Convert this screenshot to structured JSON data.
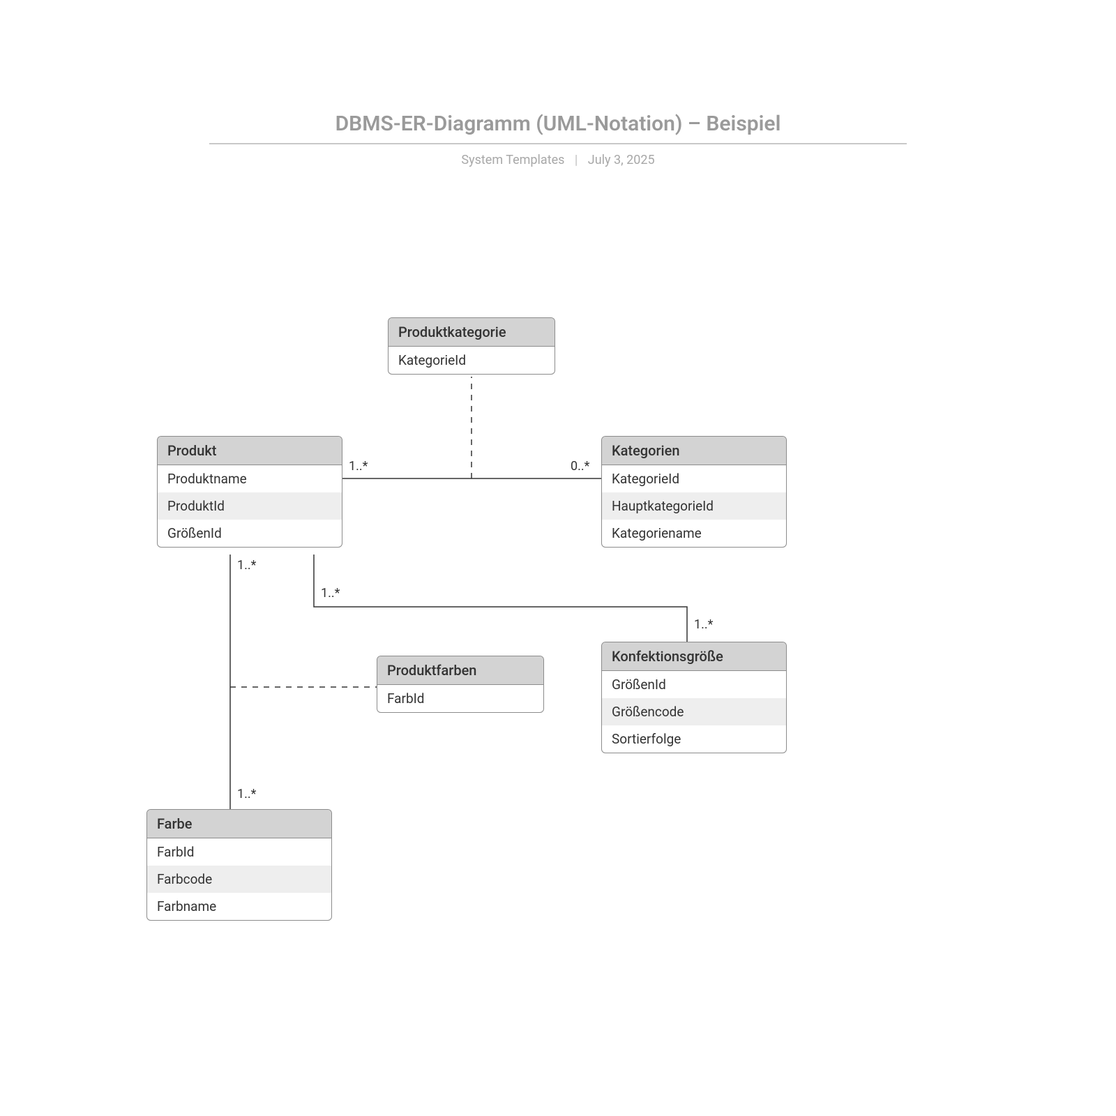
{
  "header": {
    "title": "DBMS-ER-Diagramm (UML-Notation) – Beispiel",
    "subtitle_left": "System Templates",
    "subtitle_right": "July 3, 2025"
  },
  "entities": {
    "produktkategorie": {
      "title": "Produktkategorie",
      "attrs": [
        "KategorieId"
      ]
    },
    "produkt": {
      "title": "Produkt",
      "attrs": [
        "Produktname",
        "ProduktId",
        "GrößenId"
      ]
    },
    "kategorien": {
      "title": "Kategorien",
      "attrs": [
        "KategorieId",
        "HauptkategorieId",
        "Kategoriename"
      ]
    },
    "produktfarben": {
      "title": "Produktfarben",
      "attrs": [
        "FarbId"
      ]
    },
    "konfektionsgroesse": {
      "title": "Konfektionsgröße",
      "attrs": [
        "GrößenId",
        "Größencode",
        "Sortierfolge"
      ]
    },
    "farbe": {
      "title": "Farbe",
      "attrs": [
        "FarbId",
        "Farbcode",
        "Farbname"
      ]
    }
  },
  "mult": {
    "prod_kat_left": "1..*",
    "prod_kat_right": "0..*",
    "prod_farbe_top": "1..*",
    "prod_farbe_bot": "1..*",
    "prod_konf_left": "1..*",
    "prod_konf_right": "1..*"
  }
}
